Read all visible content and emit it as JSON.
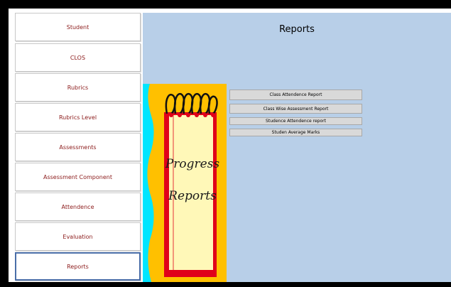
{
  "sidebar": {
    "items": [
      {
        "label": "Student"
      },
      {
        "label": "CLOS"
      },
      {
        "label": "Rubrics"
      },
      {
        "label": "Rubrics Level"
      },
      {
        "label": "Assessments"
      },
      {
        "label": "Assessment Component"
      },
      {
        "label": "Attendence"
      },
      {
        "label": "Evaluation"
      },
      {
        "label": "Reports"
      }
    ],
    "active": "Reports"
  },
  "main": {
    "title": "Reports",
    "poster": {
      "line1": "Progress",
      "line2": "Reports"
    },
    "report_buttons": [
      {
        "label": "Class Attendence Report"
      },
      {
        "label": "Class Wise Assessment Report"
      },
      {
        "label": "Studence Attendence report"
      },
      {
        "label": "Studen Average Marks"
      }
    ]
  },
  "colors": {
    "content_bg": "#b8cfe8",
    "nav_text": "#8b1a1a",
    "active_border": "#4a6ea8",
    "poster_orange": "#ffc000",
    "poster_cyan": "#00e5ff",
    "poster_red": "#e0001a"
  }
}
